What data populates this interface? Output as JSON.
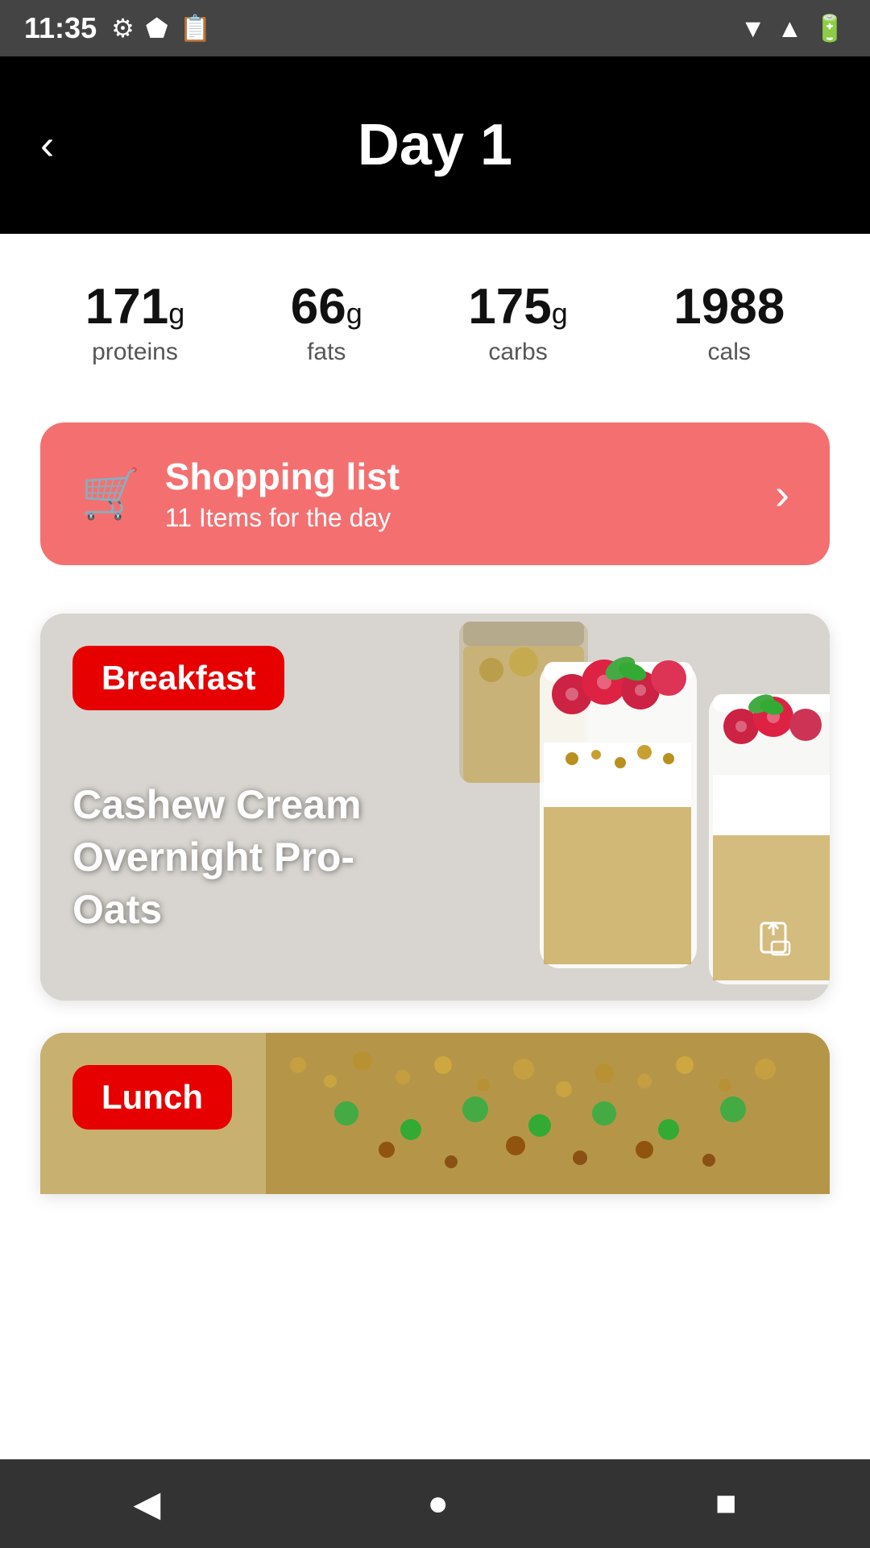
{
  "statusBar": {
    "time": "11:35",
    "icons": [
      "gear",
      "shield",
      "clipboard"
    ]
  },
  "header": {
    "title": "Day 1",
    "back_label": "‹"
  },
  "nutrition": {
    "proteins_value": "171",
    "proteins_unit": "g",
    "proteins_label": "proteins",
    "fats_value": "66",
    "fats_unit": "g",
    "fats_label": "fats",
    "carbs_value": "175",
    "carbs_unit": "g",
    "carbs_label": "carbs",
    "cals_value": "1988",
    "cals_label": "cals"
  },
  "shoppingBanner": {
    "title": "Shopping list",
    "subtitle": "11 Items for the day",
    "arrow": "›"
  },
  "meals": [
    {
      "badge": "Breakfast",
      "title": "Cashew Cream Overnight Pro-Oats",
      "type": "breakfast"
    },
    {
      "badge": "Lunch",
      "title": "",
      "type": "lunch"
    }
  ],
  "navBar": {
    "back_icon": "◀",
    "home_icon": "●",
    "square_icon": "■"
  }
}
